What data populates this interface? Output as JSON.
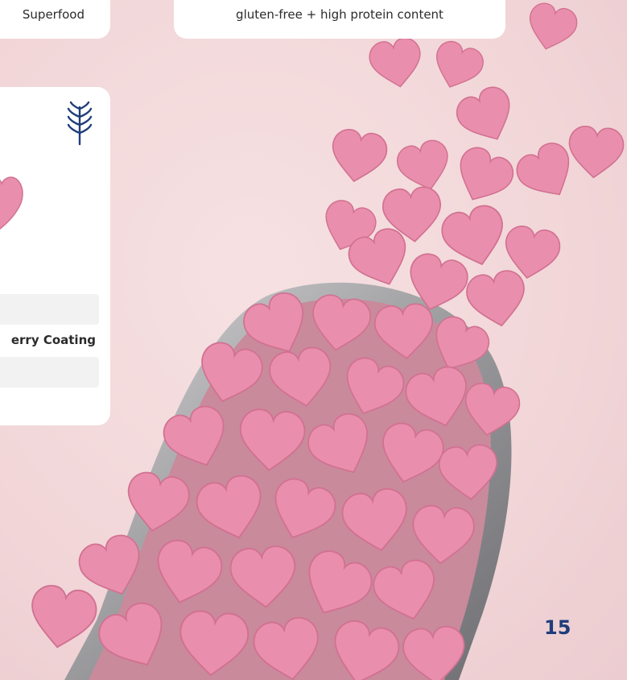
{
  "cards": {
    "top_left_label": "Superfood",
    "top_right_label": "gluten-free + high protein content"
  },
  "product": {
    "icon": "wheat-icon",
    "coating_label": "erry Coating"
  },
  "page": {
    "number": "15"
  },
  "colors": {
    "background": "#f2d7d9",
    "heart": "#e890ab",
    "accent_blue": "#1f3d7a"
  }
}
